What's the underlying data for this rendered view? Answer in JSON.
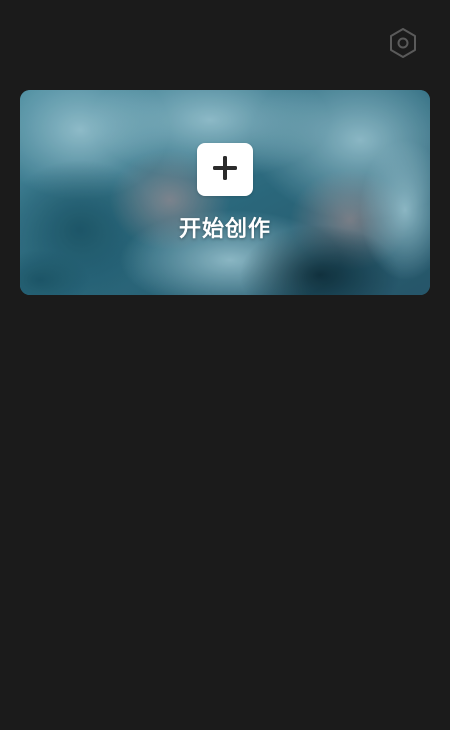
{
  "header": {
    "settings_icon": "hexagon-settings-icon"
  },
  "hero": {
    "action_icon": "plus-icon",
    "label": "开始创作"
  },
  "colors": {
    "background": "#1b1b1b",
    "card_tint": "#2f6f83",
    "icon_gray": "#5a5a5a",
    "plus_color": "#2b2b2b"
  }
}
